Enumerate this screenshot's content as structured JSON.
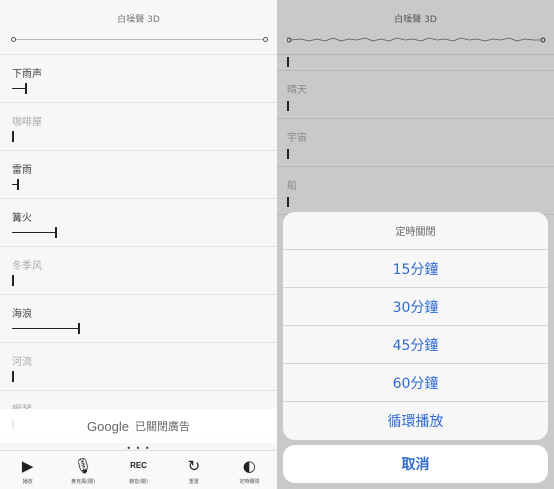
{
  "left": {
    "title": "白噪聲 3D",
    "rows": [
      {
        "label": "下雨声",
        "level": 0.05
      },
      {
        "label": "咖啡屋",
        "level": 0.0
      },
      {
        "label": "雷雨",
        "level": 0.02
      },
      {
        "label": "篝火",
        "level": 0.17
      },
      {
        "label": "冬季风",
        "level": 0.0
      },
      {
        "label": "海浪",
        "level": 0.26
      },
      {
        "label": "河流",
        "level": 0.0
      },
      {
        "label": "鋼琴",
        "level": 0.0
      }
    ],
    "ad": {
      "brand": "Google",
      "text": "已關閉廣告"
    },
    "page_dots": "• • •",
    "tabs": [
      {
        "icon": "play-icon",
        "glyph": "▶",
        "label": "播放"
      },
      {
        "icon": "mic-off-icon",
        "glyph": "🎙",
        "label": "麥克風(關)"
      },
      {
        "icon": "rec-icon",
        "glyph": "REC",
        "label": "錄音(關)"
      },
      {
        "icon": "reset-icon",
        "glyph": "↻",
        "label": "重置"
      },
      {
        "icon": "timer-icon",
        "glyph": "◐",
        "label": "定時關閉"
      }
    ]
  },
  "right": {
    "title": "白噪聲 3D",
    "rows": [
      {
        "label": ""
      },
      {
        "label": "晴天"
      },
      {
        "label": "宇宙"
      },
      {
        "label": "船"
      }
    ],
    "sheet": {
      "title": "定時關閉",
      "options": [
        "15分鐘",
        "30分鐘",
        "45分鐘",
        "60分鐘",
        "循環播放"
      ],
      "cancel": "取消"
    }
  },
  "colors": {
    "accent": "#2f6bd1",
    "overlay": "#c9c9c9"
  }
}
